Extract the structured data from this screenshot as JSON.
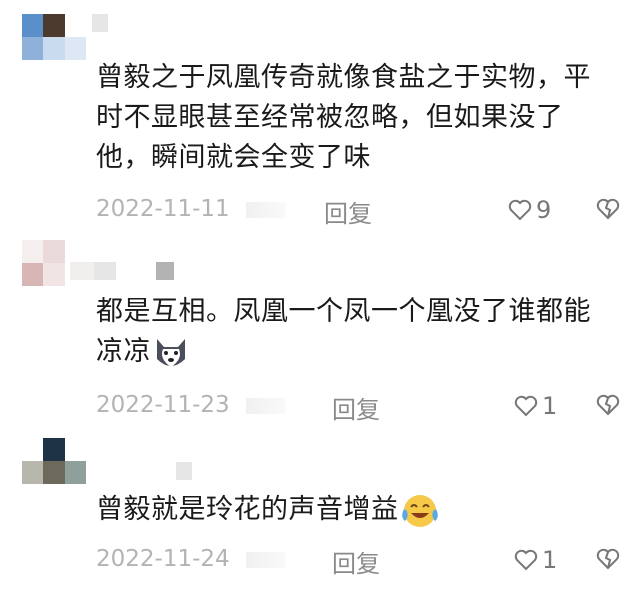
{
  "comments": [
    {
      "text": "曾毅之于凤凰传奇就像食盐之于实物，平时不显眼甚至经常被忽略，但如果没了他，瞬间就会全变了味",
      "date": "2022-11-11",
      "reply_label": "回复",
      "likes": "9",
      "avatar_colors": [
        "#5a8fc9",
        "#4b3a2d",
        "#8fb0d9",
        "#9ec2e6",
        "#c9dcef",
        "#dde8f4"
      ]
    },
    {
      "text": "都是互相。凤凰一个凤一个凰没了谁都能凉凉",
      "date": "2022-11-23",
      "reply_label": "回复",
      "likes": "1",
      "avatar_colors": [
        "#f4eeee",
        "#eadada",
        "#ffffff",
        "#d9b6b6",
        "#f0e4e4",
        "#ffffff"
      ]
    },
    {
      "text": "曾毅就是玲花的声音增益",
      "date": "2022-11-24",
      "reply_label": "回复",
      "likes": "1",
      "avatar_colors": [
        "#ffffff",
        "#1f3347",
        "#ffffff",
        "#b7b7ad",
        "#6d6a5c",
        "#8f9f9a"
      ]
    }
  ],
  "icons": {
    "like": "heart-outline-icon",
    "dislike": "broken-heart-icon",
    "emoji_dog": "husky-dog-emoji",
    "emoji_tears": "tears-of-joy-emoji"
  },
  "colors": {
    "text": "#1a1a1a",
    "meta": "#b3b3b3",
    "reply": "#8a8a8a"
  }
}
